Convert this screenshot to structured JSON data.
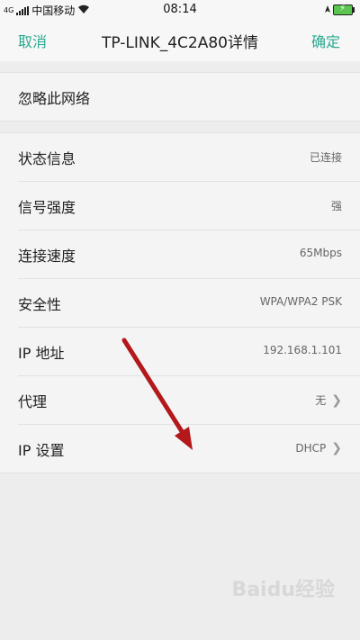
{
  "status_bar": {
    "network": "中国移动",
    "network_prefix": "4G",
    "time": "08:14"
  },
  "nav": {
    "cancel_label": "取消",
    "title": "TP-LINK_4C2A80详情",
    "ok_label": "确定"
  },
  "forget": {
    "label": "忽略此网络"
  },
  "details": [
    {
      "label": "状态信息",
      "value": "已连接",
      "chevron": false
    },
    {
      "label": "信号强度",
      "value": "强",
      "chevron": false
    },
    {
      "label": "连接速度",
      "value": "65Mbps",
      "chevron": false
    },
    {
      "label": "安全性",
      "value": "WPA/WPA2 PSK",
      "chevron": false
    },
    {
      "label": "IP 地址",
      "value": "192.168.1.101",
      "chevron": false
    },
    {
      "label": "代理",
      "value": "无",
      "chevron": true
    },
    {
      "label": "IP 设置",
      "value": "DHCP",
      "chevron": true
    }
  ],
  "watermark": "Baidu经验",
  "colors": {
    "accent": "#2aa98f",
    "annotation_arrow": "#b3181b"
  }
}
